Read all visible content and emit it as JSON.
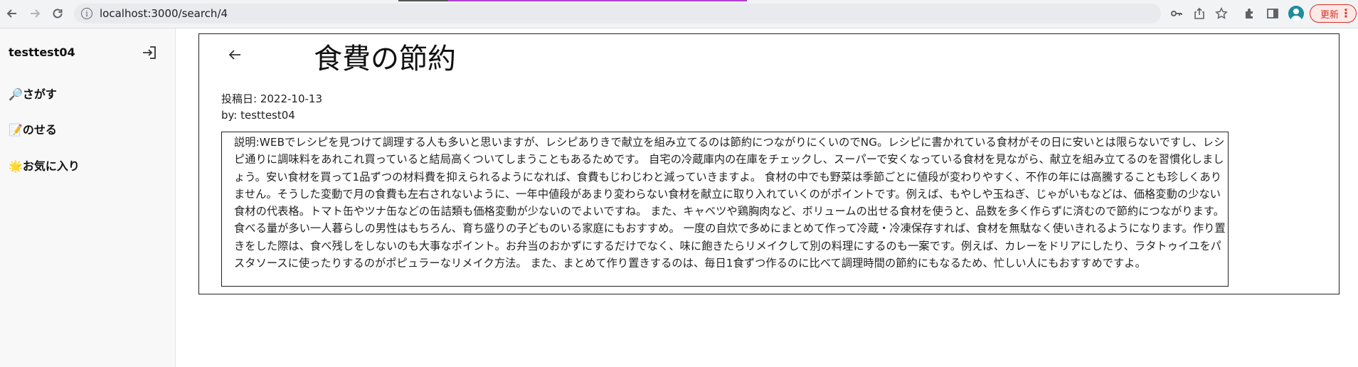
{
  "browser": {
    "url": "localhost:3000/search/4",
    "update_label": "更新"
  },
  "sidebar": {
    "user_name": "testtest04",
    "items": [
      {
        "label": "🔎さがす"
      },
      {
        "label": "📝のせる"
      },
      {
        "label": "🌟お気に入り"
      }
    ]
  },
  "post": {
    "title": "食費の節約",
    "date": "投稿日: 2022-10-13",
    "author": "by: testtest04",
    "description": "説明:WEBでレシピを見つけて調理する人も多いと思いますが、レシピありきで献立を組み立てるのは節約につながりにくいのでNG。レシピに書かれている食材がその日に安いとは限らないですし、レシピ通りに調味料をあれこれ買っていると結局高くついてしまうこともあるためです。 自宅の冷蔵庫内の在庫をチェックし、スーパーで安くなっている食材を見ながら、献立を組み立てるのを習慣化しましょう。安い食材を買って1品ずつの材料費を抑えられるようになれば、食費もじわじわと減っていきますよ。 食材の中でも野菜は季節ごとに値段が変わりやすく、不作の年には高騰することも珍しくありません。そうした変動で月の食費も左右されないように、一年中値段があまり変わらない食材を献立に取り入れていくのがポイントです。例えば、もやしや玉ねぎ、じゃがいもなどは、価格変動の少ない食材の代表格。トマト缶やツナ缶などの缶詰類も価格変動が少ないのでよいですね。 また、キャベツや鶏胸肉など、ボリュームの出せる食材を使うと、品数を多く作らずに済むので節約につながります。食べる量が多い一人暮らしの男性はもちろん、育ち盛りの子どものいる家庭にもおすすめ。 一度の自炊で多めにまとめて作って冷蔵・冷凍保存すれば、食材を無駄なく使いきれるようになります。作り置きをした際は、食べ残しをしないのも大事なポイント。お弁当のおかずにするだけでなく、味に飽きたらリメイクして別の料理にするのも一案です。例えば、カレーをドリアにしたり、ラタトゥイユをパスタソースに使ったりするのがポピュラーなリメイク方法。 また、まとめて作り置きするのは、毎日1食ずつ作るのに比べて調理時間の節約にもなるため、忙しい人にもおすすめですよ。"
  }
}
